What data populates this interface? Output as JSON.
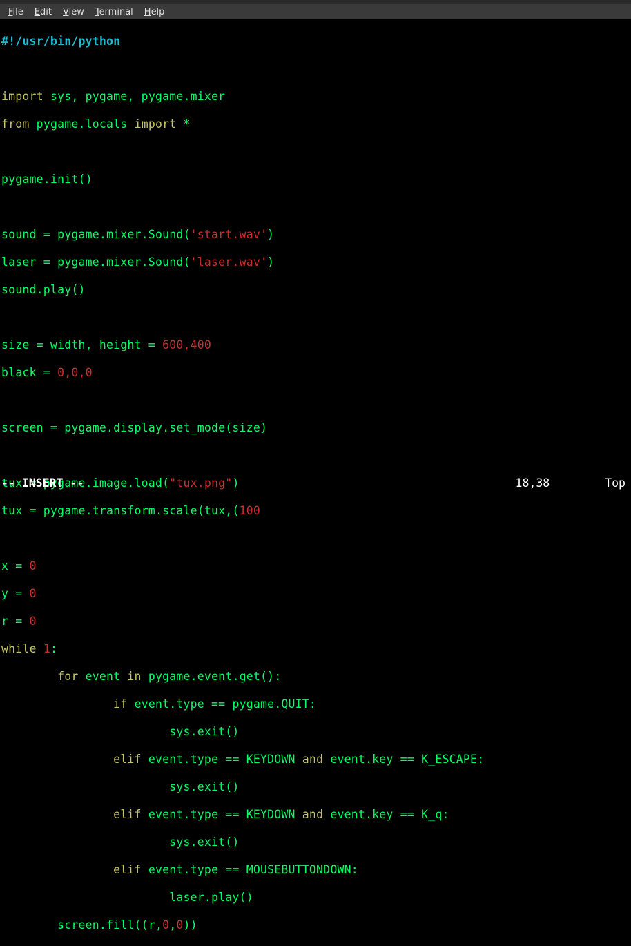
{
  "menu": {
    "file": {
      "ul": "F",
      "rest": "ile"
    },
    "edit": {
      "ul": "E",
      "rest": "dit"
    },
    "view": {
      "ul": "V",
      "rest": "iew"
    },
    "term": {
      "ul": "T",
      "rest": "erminal"
    },
    "help": {
      "ul": "H",
      "rest": "elp"
    }
  },
  "code": {
    "shebang": "#!/usr/bin/python",
    "kw_import1": "import",
    "mods1": " sys, pygame, pygame.mixer",
    "kw_from": "from",
    "mod_from": " pygame.locals ",
    "kw_import2": "import",
    "star": " *",
    "init": "pygame.init()",
    "sound_a": "sound = pygame.mixer.Sound(",
    "sq1": "'",
    "start_wav": "start.wav",
    "sq2": "'",
    "sound_b": ")",
    "laser_a": "laser = pygame.mixer.Sound(",
    "sq3": "'",
    "laser_wav": "laser.wav",
    "sq4": "'",
    "laser_b": ")",
    "play": "sound.play()",
    "size_a": "size = width, height = ",
    "size_nums": "600,400",
    "black_a": "black = ",
    "black_nums": "0,0,0",
    "screen": "screen = pygame.display.set_mode(size)",
    "tux1_a": "tux = pygame.image.load(",
    "dq1": "\"",
    "tux_png": "tux.png",
    "dq2": "\"",
    "tux1_b": ")",
    "tux2_a": "tux = pygame.transform.scale(tux,(",
    "tux2_n": "100",
    "x_a": "x = ",
    "x_n": "0",
    "y_a": "y = ",
    "y_n": "0",
    "r_a": "r = ",
    "r_n": "0",
    "while_kw": "while",
    "while_rest": " ",
    "while_n": "1",
    "while_colon": ":",
    "for_indent": "        ",
    "for_kw": "for",
    "for_mid": " event ",
    "in_kw": "in",
    "for_rest": " pygame.event.get():",
    "if_indent": "                ",
    "if_kw": "if",
    "if_rest": " event.type == pygame.QUIT:",
    "exit_indent": "                        ",
    "exit": "sys.exit()",
    "elif_kw": "elif",
    "elif1_mid": " event.type == KEYDOWN ",
    "and_kw": "and",
    "elif1_rest": " event.key == K_ESCAPE:",
    "elif2_rest": " event.key == K_q:",
    "elif3_rest": " event.type == MOUSEBUTTONDOWN:",
    "laser_play": "laser.play()",
    "fill_indent": "        ",
    "fill_a": "screen.fill((r,",
    "fill_n1": "0",
    "fill_c": ",",
    "fill_n2": "0",
    "fill_b": "))"
  },
  "status": {
    "mode": "-- INSERT --",
    "pos": "18,38",
    "scroll": "Top"
  }
}
